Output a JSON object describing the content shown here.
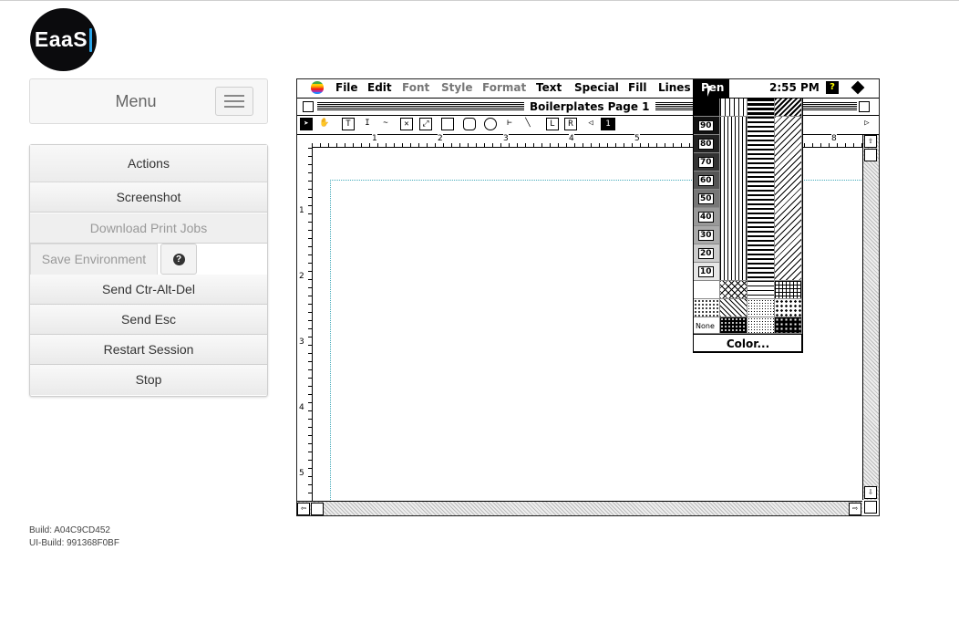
{
  "logo": {
    "text": "EaaS"
  },
  "menu": {
    "title": "Menu"
  },
  "actions": {
    "title": "Actions",
    "screenshot": "Screenshot",
    "download_print_jobs": "Download Print Jobs",
    "save_environment": "Save Environment",
    "send_ctrl_alt_del": "Send Ctr-Alt-Del",
    "send_esc": "Send Esc",
    "restart_session": "Restart Session",
    "stop": "Stop"
  },
  "build": {
    "build": "Build: A04C9CD452",
    "ui_build": "UI-Build: 991368F0BF"
  },
  "emulator": {
    "menubar": {
      "file": "File",
      "edit": "Edit",
      "font": "Font",
      "style": "Style",
      "format": "Format",
      "text": "Text",
      "special": "Special",
      "fill": "Fill",
      "lines": "Lines",
      "pen": "Pen",
      "time": "2:55 PM"
    },
    "window_title": "Boilerplates Page 1",
    "page_number": "1",
    "ruler_h": [
      "1",
      "2",
      "3",
      "4",
      "5",
      "6",
      "7",
      "8"
    ],
    "ruler_v": [
      "1",
      "2",
      "3",
      "4",
      "5"
    ],
    "pen_menu": {
      "labels": [
        "90",
        "80",
        "70",
        "60",
        "50",
        "40",
        "30",
        "20",
        "10"
      ],
      "none": "None",
      "color": "Color..."
    }
  }
}
